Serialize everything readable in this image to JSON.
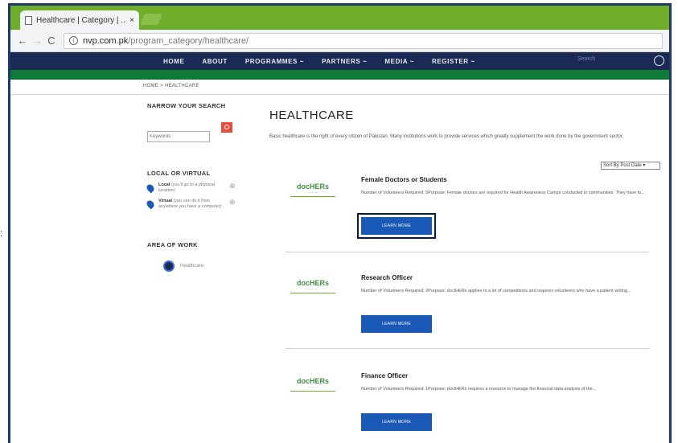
{
  "browser": {
    "tab_title": "Healthcare | Category | ...",
    "tab_close": "×",
    "url_host": "nvp.com.pk",
    "url_path": "/program_category/healthcare/"
  },
  "site_nav": {
    "items": [
      "HOME",
      "ABOUT",
      "PROGRAMMES ~",
      "PARTNERS ~",
      "MEDIA ~",
      "REGISTER ~"
    ],
    "search_placeholder": "Search"
  },
  "breadcrumb": "HOME > HEALTHCARE",
  "sidebar": {
    "narrow_heading": "NARROW YOUR SEARCH",
    "keywords_placeholder": "Keywords",
    "local_heading": "LOCAL OR VIRTUAL",
    "local_items": [
      {
        "title": "Local",
        "text": "(you'll go to a physical location)"
      },
      {
        "title": "Virtual",
        "text": "(you can do it from anywhere you have a computer)"
      }
    ],
    "area_heading": "AREA OF WORK",
    "area_item": "Healthcare"
  },
  "main": {
    "title": "HEALTHCARE",
    "description": "Basic healthcare is the right of every citizen of Pakistan. Many institutions work to provide services which greatly supplement the work done by the government sector.",
    "sort_label": "Sort By Post Date ▾"
  },
  "jobs": [
    {
      "logo": "docHERs",
      "title": "Female Doctors or Students",
      "desc": "Number of Volunteers Required: 5Purpose: Female doctors are required for Health Awareness Camps conducted in communities. They have to...",
      "button": "LEARN MORE"
    },
    {
      "logo": "docHERs",
      "title": "Research Officer",
      "desc": "Number of Volunteers Required: 2Purpose: doctHERs applies to a lot of competitions and requires volunteers who have a patient writing...",
      "button": "LEARN MORE"
    },
    {
      "logo": "docHERs",
      "title": "Finance Officer",
      "desc": "Number of Volunteers Required: 1Purpose: doctHERs requires a resource to manage the financial data analysis of the...",
      "button": "LEARN MORE"
    }
  ]
}
